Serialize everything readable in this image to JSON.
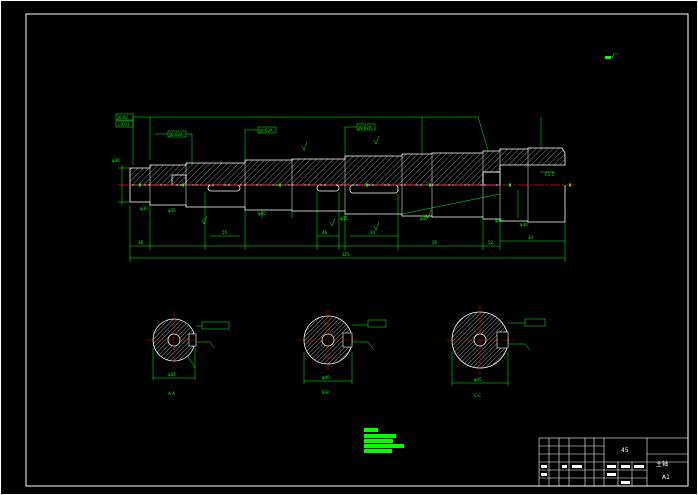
{
  "colors": {
    "background": "#000000",
    "outline": "#ffffff",
    "dimension": "#00ff00",
    "centerline": "#ff0000",
    "hatch": "#ffffff"
  },
  "drawing": {
    "roughness_note": "Ra",
    "shaft_dims": [
      "φ30",
      "φ35",
      "φ40",
      "φ45",
      "φ40",
      "φ35",
      "φ30"
    ],
    "length_dims": [
      "38",
      "55",
      "46",
      "34",
      "26",
      "52",
      "34"
    ],
    "overall_length": "325",
    "chamfer_note": "C1.5"
  },
  "sections": [
    {
      "label": "A-A",
      "dim": "φ30"
    },
    {
      "label": "B-B",
      "dim": "φ40"
    },
    {
      "label": "C-C",
      "dim": "φ45"
    }
  ],
  "notes": {
    "title": "技术要求",
    "lines": [
      "1.",
      "2.",
      "3.",
      "4."
    ]
  },
  "title_block": {
    "material": "45",
    "drawing_name": "主轴",
    "scale": "A1"
  }
}
